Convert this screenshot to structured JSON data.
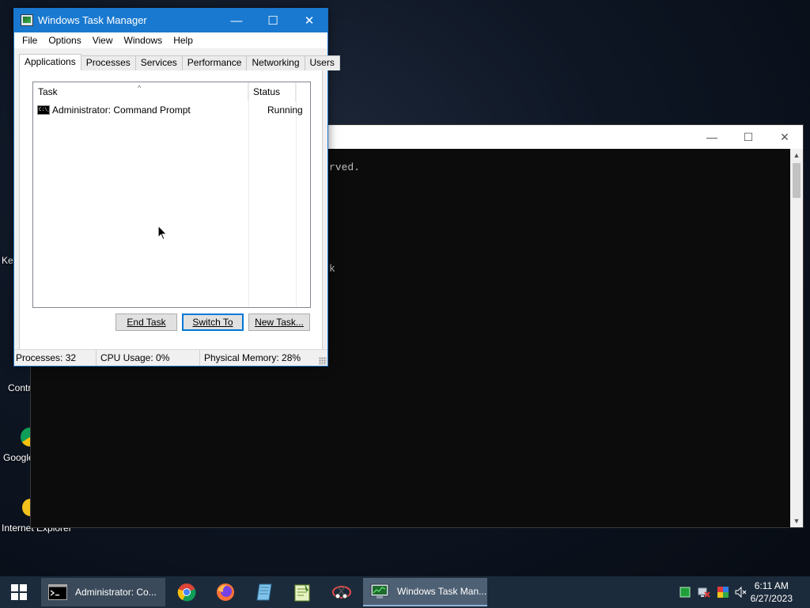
{
  "desktop": {
    "icons": [
      {
        "label": "Key"
      },
      {
        "label": "Contr"
      },
      {
        "label": "Google"
      },
      {
        "label": "Internet Explorer"
      }
    ]
  },
  "cmd_window": {
    "lines": [
      "rved.",
      "k"
    ],
    "controls": {
      "minimize": "—",
      "maximize": "☐",
      "close": "✕"
    }
  },
  "task_manager": {
    "title": "Windows Task Manager",
    "controls": {
      "minimize": "—",
      "maximize": "☐",
      "close": "✕"
    },
    "menu": [
      "File",
      "Options",
      "View",
      "Windows",
      "Help"
    ],
    "tabs": [
      "Applications",
      "Processes",
      "Services",
      "Performance",
      "Networking",
      "Users"
    ],
    "active_tab": "Applications",
    "columns": {
      "task": "Task",
      "status": "Status"
    },
    "rows": [
      {
        "task": "Administrator: Command Prompt",
        "status": "Running",
        "icon": "cmd-icon"
      }
    ],
    "buttons": {
      "end_task": "End Task",
      "switch_to": "Switch To",
      "new_task": "New Task..."
    },
    "statusbar": {
      "processes": "Processes: 32",
      "cpu": "CPU Usage: 0%",
      "memory": "Physical Memory: 28%"
    }
  },
  "taskbar": {
    "tasks": [
      {
        "label": "Administrator: Co...",
        "icon": "cmd-icon"
      },
      {
        "label": "Windows Task Man...",
        "icon": "task-manager-icon"
      }
    ],
    "pinned": [
      "chrome-icon",
      "firefox-icon",
      "notepad-icon",
      "notepad-plus-icon",
      "snipping-tool-icon"
    ],
    "tray": [
      "green-square-icon",
      "network-icon",
      "color-icon",
      "volume-muted-icon"
    ],
    "clock": {
      "time": "6:11 AM",
      "date": "6/27/2023"
    }
  },
  "colors": {
    "titlebar_active": "#1979d0",
    "taskbar": "#1c2b3b",
    "console_bg": "#0c0c0c"
  }
}
